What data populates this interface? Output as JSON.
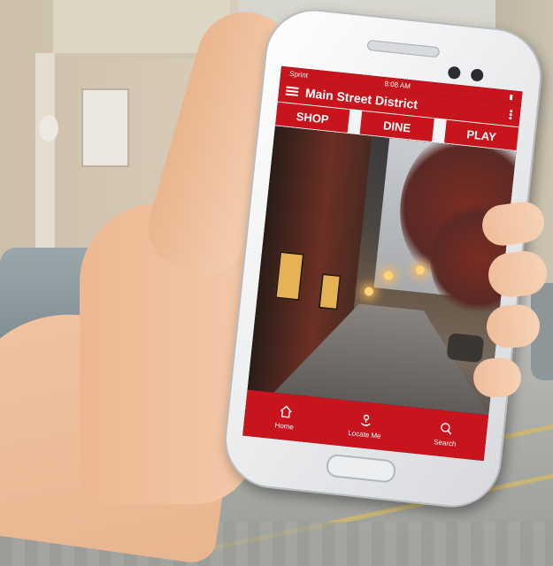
{
  "status_bar": {
    "carrier": "Sprint",
    "time": "8:08 AM"
  },
  "app_bar": {
    "title": "Main Street District"
  },
  "tabs": [
    {
      "label": "SHOP"
    },
    {
      "label": "DINE"
    },
    {
      "label": "PLAY"
    }
  ],
  "bottom_nav": [
    {
      "label": "Home",
      "icon": "home-icon"
    },
    {
      "label": "Locate Me",
      "icon": "locate-icon"
    },
    {
      "label": "Search",
      "icon": "search-icon"
    }
  ],
  "colors": {
    "brand_red": "#c8151d"
  }
}
